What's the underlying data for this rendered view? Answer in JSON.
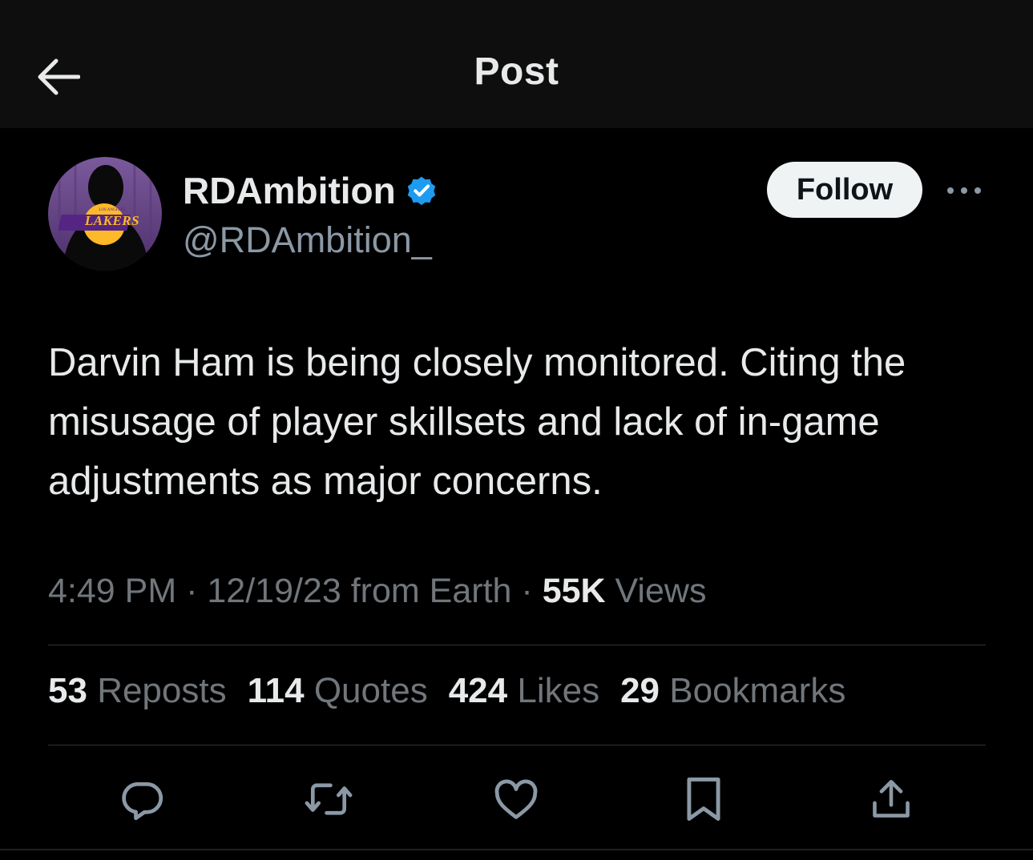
{
  "header": {
    "title": "Post",
    "back_icon": "arrow-left-icon"
  },
  "author": {
    "display_name": "RDAmbition",
    "handle": "@RDAmbition_",
    "verified": true,
    "verified_color": "#1d9bf0",
    "avatar_logo_text": "LAKERS",
    "avatar_logo_subtext": "LOS ANGELES"
  },
  "follow_button": {
    "label": "Follow"
  },
  "post": {
    "text": "Darvin Ham is being closely monitored. Citing the misusage of player skillsets and lack of in-game adjustments as major concerns.",
    "time": "4:49 PM",
    "date": "12/19/23",
    "source": "from Earth",
    "separator": "·",
    "views_count": "55K",
    "views_label": "Views"
  },
  "stats": [
    {
      "count": "53",
      "label": "Reposts"
    },
    {
      "count": "114",
      "label": "Quotes"
    },
    {
      "count": "424",
      "label": "Likes"
    },
    {
      "count": "29",
      "label": "Bookmarks"
    }
  ],
  "actions": [
    "reply-icon",
    "repost-icon",
    "like-icon",
    "bookmark-icon",
    "share-icon"
  ],
  "colors": {
    "background": "#000000",
    "header_background": "#0e0e0e",
    "text_primary": "#e7e9ea",
    "text_secondary": "#71767b",
    "divider": "#2f3336",
    "avatar_purple": "#6b4a8a",
    "lakers_gold": "#fdb927"
  }
}
